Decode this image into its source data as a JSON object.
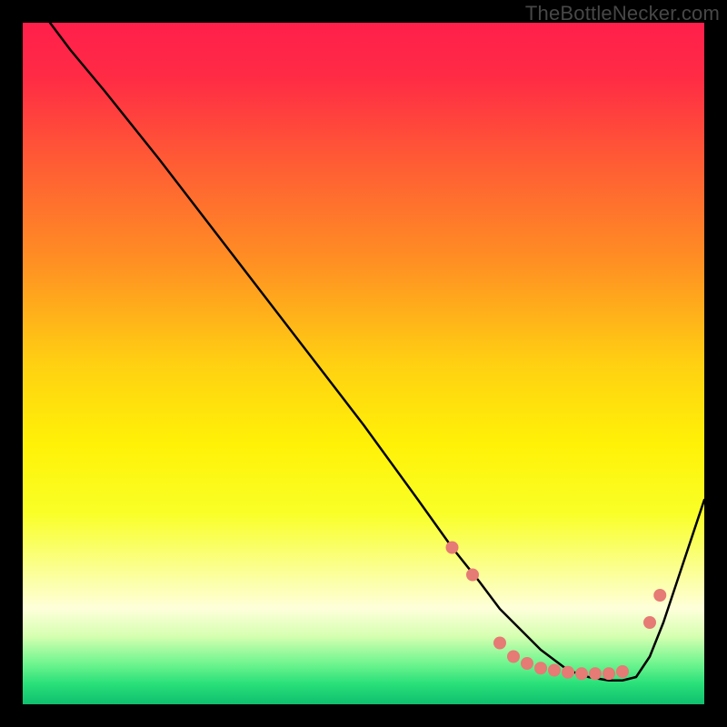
{
  "watermark": "TheBottleNecker.com",
  "chart_data": {
    "type": "line",
    "title": "",
    "xlabel": "",
    "ylabel": "",
    "xlim": [
      0,
      100
    ],
    "ylim": [
      0,
      100
    ],
    "grid": false,
    "background_gradient": {
      "stops": [
        {
          "offset": 0.0,
          "color": "#ff1f4b"
        },
        {
          "offset": 0.08,
          "color": "#ff2b45"
        },
        {
          "offset": 0.2,
          "color": "#ff5a35"
        },
        {
          "offset": 0.35,
          "color": "#ff8f23"
        },
        {
          "offset": 0.5,
          "color": "#ffd012"
        },
        {
          "offset": 0.62,
          "color": "#fff207"
        },
        {
          "offset": 0.72,
          "color": "#f9ff27"
        },
        {
          "offset": 0.8,
          "color": "#fbff8e"
        },
        {
          "offset": 0.86,
          "color": "#feffda"
        },
        {
          "offset": 0.9,
          "color": "#d6ffb1"
        },
        {
          "offset": 0.94,
          "color": "#70f58f"
        },
        {
          "offset": 0.97,
          "color": "#29e079"
        },
        {
          "offset": 1.0,
          "color": "#0fbf6e"
        }
      ]
    },
    "series": [
      {
        "name": "bottleneck-curve",
        "color": "#000000",
        "width": 2.5,
        "x": [
          4,
          7,
          12,
          20,
          30,
          40,
          50,
          58,
          63,
          67,
          70,
          73,
          76,
          80,
          83,
          86,
          88,
          90,
          92,
          94,
          96,
          100
        ],
        "y": [
          100,
          96,
          90,
          80,
          67,
          54,
          41,
          30,
          23,
          18,
          14,
          11,
          8,
          5,
          4,
          3.5,
          3.5,
          4,
          7,
          12,
          18,
          30
        ]
      }
    ],
    "markers": {
      "name": "optimum-dots",
      "color": "#e67a74",
      "radius": 7,
      "points": [
        {
          "x": 63,
          "y": 23
        },
        {
          "x": 66,
          "y": 19
        },
        {
          "x": 70,
          "y": 9
        },
        {
          "x": 72,
          "y": 7
        },
        {
          "x": 74,
          "y": 6
        },
        {
          "x": 76,
          "y": 5.3
        },
        {
          "x": 78,
          "y": 5
        },
        {
          "x": 80,
          "y": 4.7
        },
        {
          "x": 82,
          "y": 4.5
        },
        {
          "x": 84,
          "y": 4.5
        },
        {
          "x": 86,
          "y": 4.5
        },
        {
          "x": 88,
          "y": 4.8
        },
        {
          "x": 92,
          "y": 12
        },
        {
          "x": 93.5,
          "y": 16
        }
      ]
    }
  }
}
